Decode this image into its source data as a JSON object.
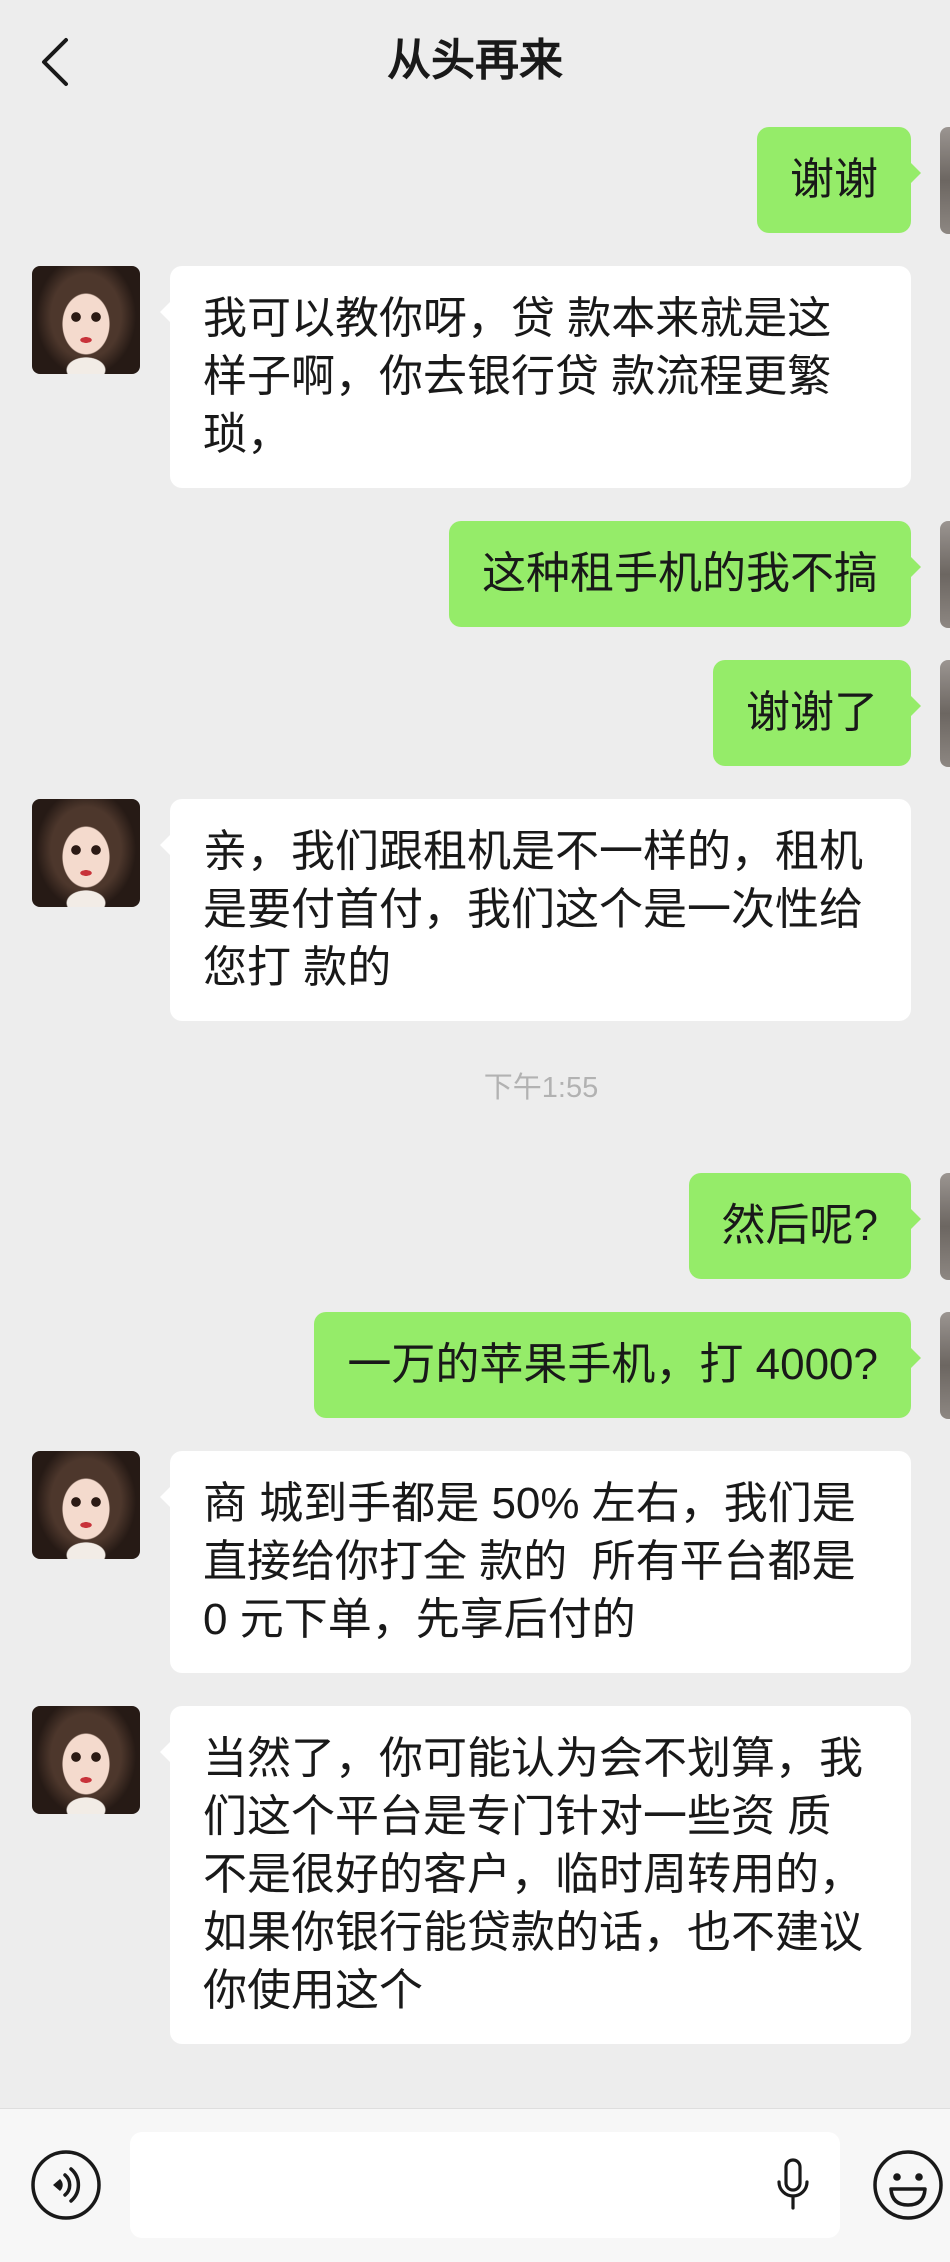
{
  "colors": {
    "background": "#ededed",
    "outgoing_bubble": "#95ec69",
    "incoming_bubble": "#ffffff",
    "text": "#191919",
    "timestamp": "#b2b2b2",
    "input_bar": "#f7f7f7"
  },
  "icons": {
    "back": "chevron-left-icon",
    "contact_avatar": "avatar-photo",
    "voice": "voice-input-icon",
    "microphone": "microphone-icon",
    "emoji": "emoji-icon"
  },
  "header": {
    "title": "从头再来"
  },
  "chat": {
    "messages": [
      {
        "outgoing": true,
        "lines": [
          "谢谢"
        ]
      },
      {
        "outgoing": false,
        "lines": [
          "我可以教你呀，贷 款本来就是这",
          "样子啊，你去银行贷 款流程更繁",
          "琐，"
        ]
      },
      {
        "outgoing": true,
        "lines": [
          "这种租手机的我不搞"
        ]
      },
      {
        "outgoing": true,
        "lines": [
          "谢谢了"
        ]
      },
      {
        "outgoing": false,
        "lines": [
          "亲，我们跟租机是不一样的，租机",
          "是要付首付，我们这个是一次性给",
          "您打 款的"
        ]
      },
      {
        "outgoing": true,
        "lines": [
          "然后呢?"
        ]
      },
      {
        "outgoing": true,
        "lines": [
          "一万的苹果手机，打 4000?"
        ]
      },
      {
        "outgoing": false,
        "lines": [
          "商 城到手都是 50% 左右，我们是",
          "直接给你打全 款的  所有平台都是",
          "0 元下单，先享后付的"
        ]
      },
      {
        "outgoing": false,
        "lines": [
          "当然了，你可能认为会不划算，我",
          "们这个平台是专门针对一些资 质",
          "不是很好的客户，临时周转用的，",
          "如果你银行能贷款的话，也不建议",
          "你使用这个"
        ]
      }
    ],
    "timestamp": "下午1:55"
  },
  "input_bar": {
    "message_value": ""
  }
}
